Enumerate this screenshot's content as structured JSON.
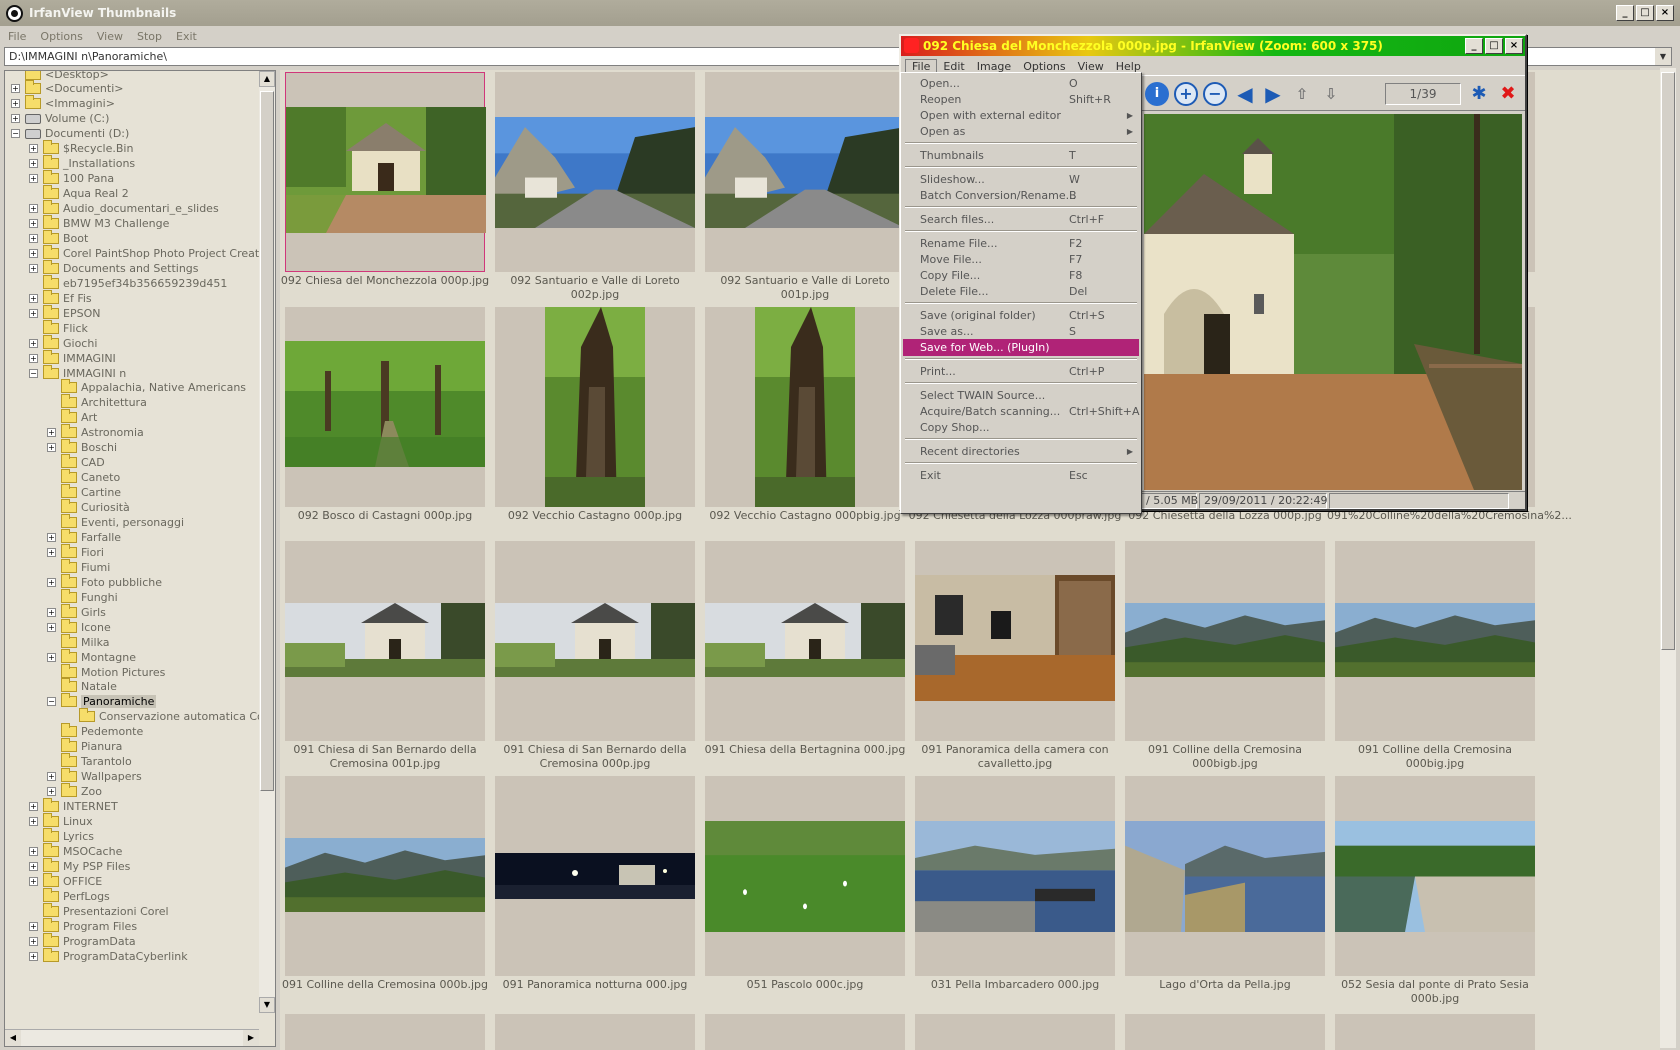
{
  "app": {
    "title": "IrfanView Thumbnails",
    "menu": [
      "File",
      "Options",
      "View",
      "Stop",
      "Exit"
    ],
    "path": "D:\\IMMAGINI n\\Panoramiche\\"
  },
  "window_buttons": {
    "minimize": "_",
    "maximize": "□",
    "close": "×"
  },
  "tree": [
    {
      "label": "<Desktop>",
      "depth": 0,
      "expander": "none",
      "icon": "folder"
    },
    {
      "label": "<Documenti>",
      "depth": 0,
      "expander": "plus",
      "icon": "folder"
    },
    {
      "label": "<Immagini>",
      "depth": 0,
      "expander": "plus",
      "icon": "folder"
    },
    {
      "label": "Volume (C:)",
      "depth": 0,
      "expander": "plus",
      "icon": "drive"
    },
    {
      "label": "Documenti (D:)",
      "depth": 0,
      "expander": "minus",
      "icon": "drive"
    },
    {
      "label": "$Recycle.Bin",
      "depth": 1,
      "expander": "plus",
      "icon": "folder"
    },
    {
      "label": "_Installations",
      "depth": 1,
      "expander": "plus",
      "icon": "folder"
    },
    {
      "label": "100 Pana",
      "depth": 1,
      "expander": "plus",
      "icon": "folder"
    },
    {
      "label": "Aqua Real 2",
      "depth": 1,
      "expander": "none",
      "icon": "folder"
    },
    {
      "label": "Audio_documentari_e_slides",
      "depth": 1,
      "expander": "plus",
      "icon": "folder"
    },
    {
      "label": "BMW M3 Challenge",
      "depth": 1,
      "expander": "plus",
      "icon": "folder"
    },
    {
      "label": "Boot",
      "depth": 1,
      "expander": "plus",
      "icon": "folder"
    },
    {
      "label": "Corel PaintShop Photo Project Creator",
      "depth": 1,
      "expander": "plus",
      "icon": "folder"
    },
    {
      "label": "Documents and Settings",
      "depth": 1,
      "expander": "plus",
      "icon": "folder"
    },
    {
      "label": "eb7195ef34b356659239d451",
      "depth": 1,
      "expander": "none",
      "icon": "folder"
    },
    {
      "label": "Ef Fis",
      "depth": 1,
      "expander": "plus",
      "icon": "folder"
    },
    {
      "label": "EPSON",
      "depth": 1,
      "expander": "plus",
      "icon": "folder"
    },
    {
      "label": "Flick",
      "depth": 1,
      "expander": "none",
      "icon": "folder"
    },
    {
      "label": "Giochi",
      "depth": 1,
      "expander": "plus",
      "icon": "folder"
    },
    {
      "label": "IMMAGINI",
      "depth": 1,
      "expander": "plus",
      "icon": "folder"
    },
    {
      "label": "IMMAGINI n",
      "depth": 1,
      "expander": "minus",
      "icon": "folder"
    },
    {
      "label": "Appalachia, Native Americans",
      "depth": 2,
      "expander": "none",
      "icon": "folder"
    },
    {
      "label": "Architettura",
      "depth": 2,
      "expander": "none",
      "icon": "folder"
    },
    {
      "label": "Art",
      "depth": 2,
      "expander": "none",
      "icon": "folder"
    },
    {
      "label": "Astronomia",
      "depth": 2,
      "expander": "plus",
      "icon": "folder"
    },
    {
      "label": "Boschi",
      "depth": 2,
      "expander": "plus",
      "icon": "folder"
    },
    {
      "label": "CAD",
      "depth": 2,
      "expander": "none",
      "icon": "folder"
    },
    {
      "label": "Caneto",
      "depth": 2,
      "expander": "none",
      "icon": "folder"
    },
    {
      "label": "Cartine",
      "depth": 2,
      "expander": "none",
      "icon": "folder"
    },
    {
      "label": "Curiosità",
      "depth": 2,
      "expander": "none",
      "icon": "folder"
    },
    {
      "label": "Eventi, personaggi",
      "depth": 2,
      "expander": "none",
      "icon": "folder"
    },
    {
      "label": "Farfalle",
      "depth": 2,
      "expander": "plus",
      "icon": "folder"
    },
    {
      "label": "Fiori",
      "depth": 2,
      "expander": "plus",
      "icon": "folder"
    },
    {
      "label": "Fiumi",
      "depth": 2,
      "expander": "none",
      "icon": "folder"
    },
    {
      "label": "Foto pubbliche",
      "depth": 2,
      "expander": "plus",
      "icon": "folder"
    },
    {
      "label": "Funghi",
      "depth": 2,
      "expander": "none",
      "icon": "folder"
    },
    {
      "label": "Girls",
      "depth": 2,
      "expander": "plus",
      "icon": "folder"
    },
    {
      "label": "Icone",
      "depth": 2,
      "expander": "plus",
      "icon": "folder"
    },
    {
      "label": "Milka",
      "depth": 2,
      "expander": "none",
      "icon": "folder"
    },
    {
      "label": "Montagne",
      "depth": 2,
      "expander": "plus",
      "icon": "folder"
    },
    {
      "label": "Motion Pictures",
      "depth": 2,
      "expander": "none",
      "icon": "folder"
    },
    {
      "label": "Natale",
      "depth": 2,
      "expander": "none",
      "icon": "folder"
    },
    {
      "label": "Panoramiche",
      "depth": 2,
      "expander": "minus",
      "icon": "folder",
      "selected": true
    },
    {
      "label": "Conservazione automatica Corel",
      "depth": 3,
      "expander": "none",
      "icon": "folder"
    },
    {
      "label": "Pedemonte",
      "depth": 2,
      "expander": "none",
      "icon": "folder"
    },
    {
      "label": "Pianura",
      "depth": 2,
      "expander": "none",
      "icon": "folder"
    },
    {
      "label": "Tarantolo",
      "depth": 2,
      "expander": "none",
      "icon": "folder"
    },
    {
      "label": "Wallpapers",
      "depth": 2,
      "expander": "plus",
      "icon": "folder"
    },
    {
      "label": "Zoo",
      "depth": 2,
      "expander": "plus",
      "icon": "folder"
    },
    {
      "label": "INTERNET",
      "depth": 1,
      "expander": "plus",
      "icon": "folder"
    },
    {
      "label": "Linux",
      "depth": 1,
      "expander": "plus",
      "icon": "folder"
    },
    {
      "label": "Lyrics",
      "depth": 1,
      "expander": "none",
      "icon": "folder"
    },
    {
      "label": "MSOCache",
      "depth": 1,
      "expander": "plus",
      "icon": "folder"
    },
    {
      "label": "My PSP Files",
      "depth": 1,
      "expander": "plus",
      "icon": "folder"
    },
    {
      "label": "OFFICE",
      "depth": 1,
      "expander": "plus",
      "icon": "folder"
    },
    {
      "label": "PerfLogs",
      "depth": 1,
      "expander": "none",
      "icon": "folder"
    },
    {
      "label": "Presentazioni Corel",
      "depth": 1,
      "expander": "none",
      "icon": "folder"
    },
    {
      "label": "Program Files",
      "depth": 1,
      "expander": "plus",
      "icon": "folder"
    },
    {
      "label": "ProgramData",
      "depth": 1,
      "expander": "plus",
      "icon": "folder"
    },
    {
      "label": "ProgramDataCyberlink",
      "depth": 1,
      "expander": "plus",
      "icon": "folder"
    }
  ],
  "thumbnails": [
    {
      "caption": "092 Chiesa del Monchezzola 000p.jpg",
      "shape": "landscape",
      "scene": "chapel",
      "selected": true
    },
    {
      "caption": "092 Santuario e Valle di Loreto 002p.jpg",
      "shape": "wide",
      "scene": "valley"
    },
    {
      "caption": "092 Santuario e Valle di Loreto 001p.jpg",
      "shape": "wide",
      "scene": "valley"
    },
    {
      "caption": "",
      "shape": "none",
      "scene": "hidden"
    },
    {
      "caption": "",
      "shape": "none",
      "scene": "hidden"
    },
    {
      "caption": "",
      "shape": "none",
      "scene": "hidden"
    },
    {
      "caption": "092 Bosco di Castagni 000p.jpg",
      "shape": "landscape",
      "scene": "forest"
    },
    {
      "caption": "092 Vecchio Castagno 000p.jpg",
      "shape": "portrait",
      "scene": "tree"
    },
    {
      "caption": "092 Vecchio Castagno 000pbig.jpg",
      "shape": "portrait",
      "scene": "tree"
    },
    {
      "caption": "092 Chiesetta della Lozza 000praw.jpg",
      "shape": "none",
      "scene": "hidden"
    },
    {
      "caption": "092 Chiesetta della Lozza 000p.jpg",
      "shape": "none",
      "scene": "hidden"
    },
    {
      "caption": "091%20Colline%20della%20Cremosina%2...",
      "shape": "none",
      "scene": "hidden"
    },
    {
      "caption": "091 Chiesa di San Bernardo della Cremosina 001p.jpg",
      "shape": "pano",
      "scene": "chapelpano"
    },
    {
      "caption": "091 Chiesa di San Bernardo della Cremosina 000p.jpg",
      "shape": "pano",
      "scene": "chapelpano"
    },
    {
      "caption": "091 Chiesa della Bertagnina 000.jpg",
      "shape": "pano",
      "scene": "chapelpano"
    },
    {
      "caption": "091 Panoramica della camera con cavalletto.jpg",
      "shape": "landscape",
      "scene": "room"
    },
    {
      "caption": "091 Colline della Cremosina 000bigb.jpg",
      "shape": "pano",
      "scene": "hills"
    },
    {
      "caption": "091 Colline della Cremosina 000big.jpg",
      "shape": "pano",
      "scene": "hills"
    },
    {
      "caption": "091 Colline della Cremosina 000b.jpg",
      "shape": "pano",
      "scene": "hills"
    },
    {
      "caption": "091 Panoramica notturna 000.jpg",
      "shape": "thin",
      "scene": "night"
    },
    {
      "caption": "051 Pascolo 000c.jpg",
      "shape": "wide",
      "scene": "meadow"
    },
    {
      "caption": "031 Pella Imbarcadero 000.jpg",
      "shape": "wide",
      "scene": "lake"
    },
    {
      "caption": "Lago d'Orta da Pella.jpg",
      "shape": "wide",
      "scene": "lake2"
    },
    {
      "caption": "052 Sesia dal ponte di Prato Sesia 000b.jpg",
      "shape": "wide",
      "scene": "river"
    }
  ],
  "viewer": {
    "title": "092 Chiesa del Monchezzola 000p.jpg - IrfanView (Zoom: 600 x 375)",
    "menu": [
      "File",
      "Edit",
      "Image",
      "Options",
      "View",
      "Help"
    ],
    "page": "1/39",
    "status": {
      "size": "/ 5.05 MB",
      "datetime": "29/09/2011 / 20:22:49"
    },
    "toolbar_icons": [
      "info-icon",
      "zoom-in-icon",
      "zoom-out-icon",
      "previous-icon",
      "next-icon",
      "first-page-icon",
      "last-page-icon",
      "settings-icon",
      "exit-icon"
    ]
  },
  "file_menu": [
    {
      "label": "Open...",
      "shortcut": "O"
    },
    {
      "label": "Reopen",
      "shortcut": "Shift+R"
    },
    {
      "label": "Open with external editor",
      "shortcut": "",
      "submenu": true
    },
    {
      "label": "Open as",
      "shortcut": "",
      "submenu": true
    },
    {
      "sep": true
    },
    {
      "label": "Thumbnails",
      "shortcut": "T"
    },
    {
      "sep": true
    },
    {
      "label": "Slideshow...",
      "shortcut": "W"
    },
    {
      "label": "Batch Conversion/Rename...",
      "shortcut": "B"
    },
    {
      "sep": true
    },
    {
      "label": "Search files...",
      "shortcut": "Ctrl+F"
    },
    {
      "sep": true
    },
    {
      "label": "Rename File...",
      "shortcut": "F2"
    },
    {
      "label": "Move File...",
      "shortcut": "F7"
    },
    {
      "label": "Copy File...",
      "shortcut": "F8"
    },
    {
      "label": "Delete File...",
      "shortcut": "Del"
    },
    {
      "sep": true
    },
    {
      "label": "Save (original folder)",
      "shortcut": "Ctrl+S"
    },
    {
      "label": "Save as...",
      "shortcut": "S"
    },
    {
      "label": "Save for Web... (PlugIn)",
      "shortcut": "",
      "highlighted": true
    },
    {
      "sep": true
    },
    {
      "label": "Print...",
      "shortcut": "Ctrl+P"
    },
    {
      "sep": true
    },
    {
      "label": "Select TWAIN Source...",
      "shortcut": ""
    },
    {
      "label": "Acquire/Batch scanning...",
      "shortcut": "Ctrl+Shift+A"
    },
    {
      "label": "Copy Shop...",
      "shortcut": ""
    },
    {
      "sep": true
    },
    {
      "label": "Recent directories",
      "shortcut": "",
      "submenu": true
    },
    {
      "sep": true
    },
    {
      "label": "Exit",
      "shortcut": "Esc"
    }
  ],
  "colors": {
    "highlight": "#b02377",
    "selection_border": "#d0377a",
    "tile": "#cbc3b7",
    "viewer_title_text": "#ffff22"
  }
}
